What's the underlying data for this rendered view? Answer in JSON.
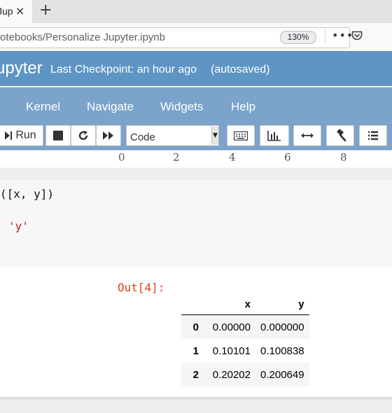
{
  "browser": {
    "tab_title": "Jup",
    "close_glyph": "×",
    "new_tab_glyph": "+",
    "url": "otebooks/Personalize Jupyter.ipynb",
    "zoom": "130%",
    "more_glyph": "•••"
  },
  "jupyter": {
    "logo_text": "upyter",
    "checkpoint": "Last Checkpoint: an hour ago",
    "autosave": "(autosaved)"
  },
  "menu": {
    "items": [
      "Kernel",
      "Navigate",
      "Widgets",
      "Help"
    ]
  },
  "toolbar": {
    "run_label": "Run",
    "cell_type": "Code"
  },
  "plot_axis": {
    "ticks": [
      "0",
      "2",
      "4",
      "6",
      "8"
    ]
  },
  "cell": {
    "code_line1": "([x, y])",
    "code_line2": "'y'",
    "out_prompt": "Out[4]:"
  },
  "dataframe": {
    "columns": [
      "",
      "x",
      "y"
    ],
    "rows": [
      {
        "index": "0",
        "x": "0.00000",
        "y": "0.000000"
      },
      {
        "index": "1",
        "x": "0.10101",
        "y": "0.100838"
      },
      {
        "index": "2",
        "x": "0.20202",
        "y": "0.200649"
      }
    ]
  },
  "colors": {
    "header_bg": "#5f95c4",
    "menubar_bg": "#7ba3cc",
    "out_prompt": "#d84315",
    "string_literal": "#ba2121"
  }
}
